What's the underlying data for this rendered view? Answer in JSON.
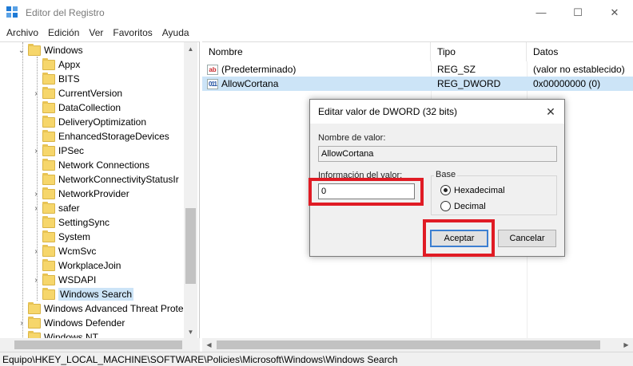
{
  "window": {
    "title": "Editor del Registro",
    "controls": {
      "minimize": "—",
      "maximize": "☐",
      "close": "✕"
    }
  },
  "menu": [
    "Archivo",
    "Edición",
    "Ver",
    "Favoritos",
    "Ayuda"
  ],
  "tree": {
    "items": [
      {
        "label": "Windows",
        "expand": "⌄",
        "level": 1
      },
      {
        "label": "Appx",
        "expand": "",
        "level": 2
      },
      {
        "label": "BITS",
        "expand": "",
        "level": 2
      },
      {
        "label": "CurrentVersion",
        "expand": "›",
        "level": 2
      },
      {
        "label": "DataCollection",
        "expand": "",
        "level": 2
      },
      {
        "label": "DeliveryOptimization",
        "expand": "",
        "level": 2
      },
      {
        "label": "EnhancedStorageDevices",
        "expand": "",
        "level": 2
      },
      {
        "label": "IPSec",
        "expand": "›",
        "level": 2
      },
      {
        "label": "Network Connections",
        "expand": "",
        "level": 2
      },
      {
        "label": "NetworkConnectivityStatusIr",
        "expand": "",
        "level": 2
      },
      {
        "label": "NetworkProvider",
        "expand": "›",
        "level": 2
      },
      {
        "label": "safer",
        "expand": "›",
        "level": 2
      },
      {
        "label": "SettingSync",
        "expand": "",
        "level": 2
      },
      {
        "label": "System",
        "expand": "",
        "level": 2
      },
      {
        "label": "WcmSvc",
        "expand": "›",
        "level": 2
      },
      {
        "label": "WorkplaceJoin",
        "expand": "",
        "level": 2
      },
      {
        "label": "WSDAPI",
        "expand": "›",
        "level": 2
      },
      {
        "label": "Windows Search",
        "expand": "",
        "level": 2,
        "selected": true
      },
      {
        "label": "Windows Advanced Threat Prote",
        "expand": "",
        "level": 1
      },
      {
        "label": "Windows Defender",
        "expand": "›",
        "level": 1
      },
      {
        "label": "Windows NT",
        "expand": "",
        "level": 1
      }
    ]
  },
  "list": {
    "columns": [
      "Nombre",
      "Tipo",
      "Datos"
    ],
    "rows": [
      {
        "icon": "ab",
        "name": "(Predeterminado)",
        "type": "REG_SZ",
        "data": "(valor no establecido)"
      },
      {
        "icon": "011",
        "name": "AllowCortana",
        "type": "REG_DWORD",
        "data": "0x00000000 (0)",
        "selected": true
      }
    ]
  },
  "status": {
    "path": "Equipo\\HKEY_LOCAL_MACHINE\\SOFTWARE\\Policies\\Microsoft\\Windows\\Windows Search"
  },
  "dialog": {
    "title": "Editar valor de DWORD (32 bits)",
    "close": "✕",
    "value_name_label": "Nombre de valor:",
    "value_name": "AllowCortana",
    "value_data_label": "Información del valor:",
    "value_data": "0",
    "base_label": "Base",
    "base_options": [
      "Hexadecimal",
      "Decimal"
    ],
    "base_selected": "Hexadecimal",
    "ok_label": "Aceptar",
    "cancel_label": "Cancelar"
  },
  "colors": {
    "highlight": "#e01b24",
    "selection": "#cce4f7",
    "default_button_border": "#3c7fd1"
  }
}
